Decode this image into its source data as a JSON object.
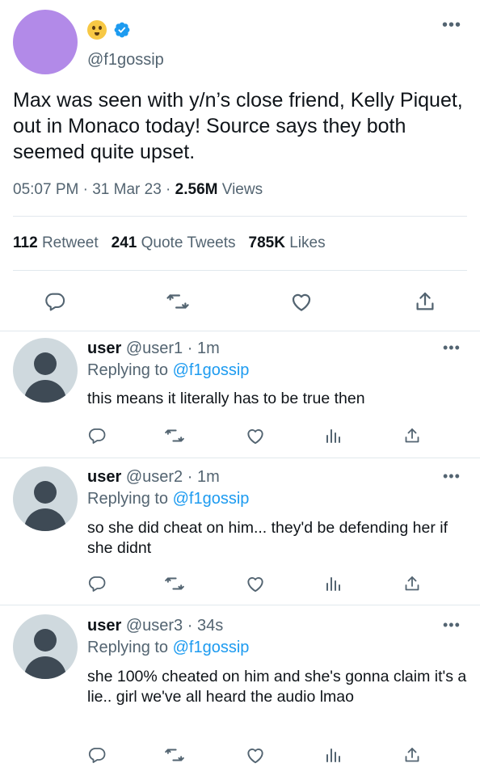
{
  "tweet": {
    "handle": "@f1gossip",
    "emoji_name": "shushing-face-emoji",
    "text": "Max was seen with y/n’s close friend, Kelly Piquet, out in Monaco today! Source says they both seemed quite upset.",
    "time": "05:07 PM",
    "date": "31 Mar 23",
    "views_count": "2.56M",
    "views_label": "Views",
    "retweets_count": "112",
    "retweets_label": "Retweet",
    "quotes_count": "241",
    "quotes_label": "Quote Tweets",
    "likes_count": "785K",
    "likes_label": "Likes",
    "more": "•••"
  },
  "replies": [
    {
      "name": "user",
      "handle": "@user1",
      "time": "1m",
      "replying_label": "Replying to",
      "replying_handle": "@f1gossip",
      "text": "this means it literally has to be true then",
      "more": "•••"
    },
    {
      "name": "user",
      "handle": "@user2",
      "time": "1m",
      "replying_label": "Replying to",
      "replying_handle": "@f1gossip",
      "text": "so she did cheat on him... they'd be defending her if she didnt",
      "more": "•••"
    },
    {
      "name": "user",
      "handle": "@user3",
      "time": "34s",
      "replying_label": "Replying to",
      "replying_handle": "@f1gossip",
      "text": "she 100% cheated on him and she's gonna claim it's a lie.. girl we've all heard the audio lmao",
      "more": "•••"
    }
  ],
  "separator": "·",
  "colors": {
    "accent": "#1d9bf0",
    "muted": "#536471",
    "avatar_main": "#b28ae8",
    "avatar_default": "#cfd9de"
  }
}
